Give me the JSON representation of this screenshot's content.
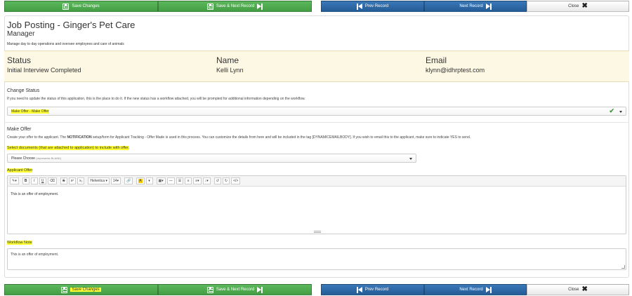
{
  "top_buttons": {
    "save": "Save Changes",
    "save_next": "Save & Next Record",
    "prev": "Prev Record",
    "next": "Next Record",
    "close": "Close"
  },
  "header": {
    "title": "Job Posting - Ginger's Pet Care",
    "position": "Manager",
    "description": "Manage day to day operations and oversee employees and care of animals"
  },
  "info": {
    "status_label": "Status",
    "status_value": "Initial Interview Completed",
    "name_label": "Name",
    "name_value": "Kelli Lynn",
    "email_label": "Email",
    "email_value": "klynn@idhrptest.com"
  },
  "change_status": {
    "label": "Change Status",
    "help": "If you need to update the status of this application, this is the place to do it. If the new status has a workflow attached, you will be prompted for additional information depending on the workflow.",
    "selected": "Make Offer - Make Offer"
  },
  "make_offer": {
    "label": "Make Offer",
    "help_pre": "Create your offer to the applicant. The ",
    "help_bold": "NOTIFICATION",
    "help_post": " setup/form for Applicant Tracking - Offer Made is used in this process. You can customize the details from here and will be included in the tag [DYNAMICEMAILBODY]. If you wish to email this to the applicant, make sure to indicate YES to send.",
    "docs_label": "Select documents (that are attached to application) to include with offer.",
    "docs_select": "Please Choose",
    "docs_select_hint": "(represents BLANK)"
  },
  "applicant_offer": {
    "label": "Applicant Offer",
    "toolbar": {
      "font": "Helvetica",
      "size": "14"
    },
    "content": "This is an offer of employment."
  },
  "workflow_note": {
    "label": "Workflow Note",
    "value": "This is an offer of employment."
  },
  "bottom_buttons": {
    "save": "Save Changes",
    "save_next": "Save & Next Record",
    "prev": "Prev Record",
    "next": "Next Record",
    "close": "Close"
  },
  "colors": {
    "green": "#5cb85c",
    "blue": "#2e6aa8",
    "highlight": "#ffff33",
    "info_bg": "#fcf8e3"
  }
}
